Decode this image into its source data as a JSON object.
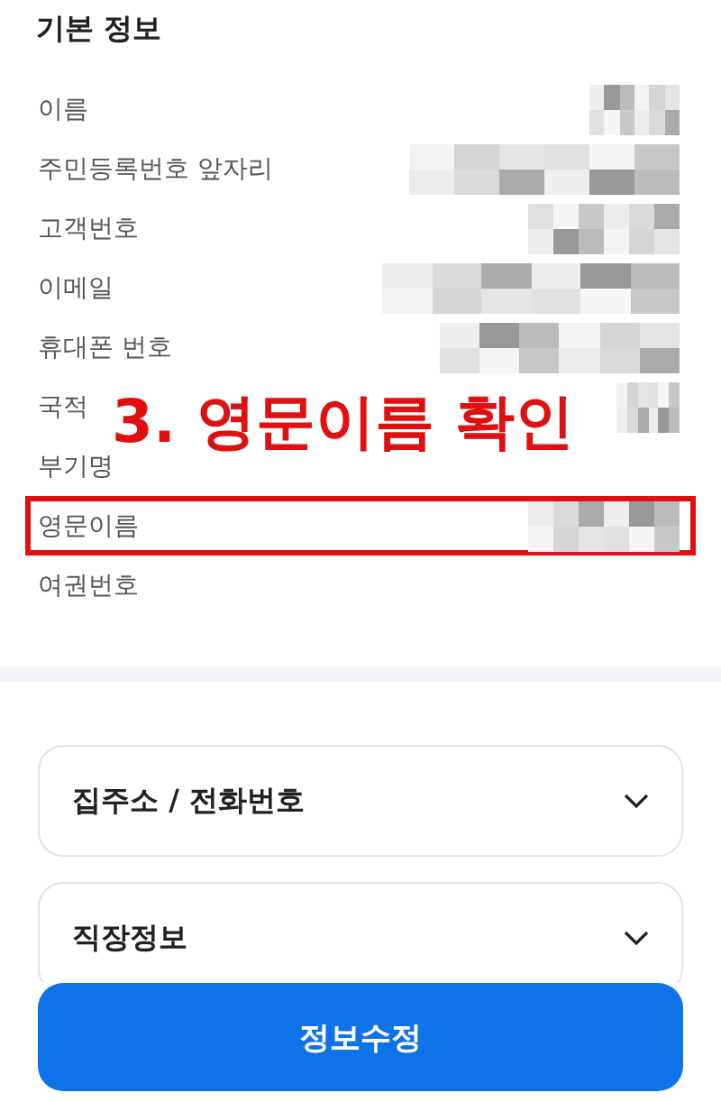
{
  "section_title": "기본 정보",
  "rows": [
    {
      "label": "이름",
      "masked": true,
      "highlighted": false
    },
    {
      "label": "주민등록번호 앞자리",
      "masked": true,
      "highlighted": false
    },
    {
      "label": "고객번호",
      "masked": true,
      "highlighted": false
    },
    {
      "label": "이메일",
      "masked": true,
      "highlighted": false
    },
    {
      "label": "휴대폰 번호",
      "masked": true,
      "highlighted": false
    },
    {
      "label": "국적",
      "masked": true,
      "highlighted": false
    },
    {
      "label": "부기명",
      "masked": false,
      "highlighted": false
    },
    {
      "label": "영문이름",
      "masked": true,
      "highlighted": true
    },
    {
      "label": "여권번호",
      "masked": false,
      "highlighted": false
    }
  ],
  "annotation": "3. 영문이름 확인",
  "accordions": [
    {
      "label": "집주소 / 전화번호",
      "expanded": false
    },
    {
      "label": "직장정보",
      "expanded": false
    }
  ],
  "button": "정보수정"
}
